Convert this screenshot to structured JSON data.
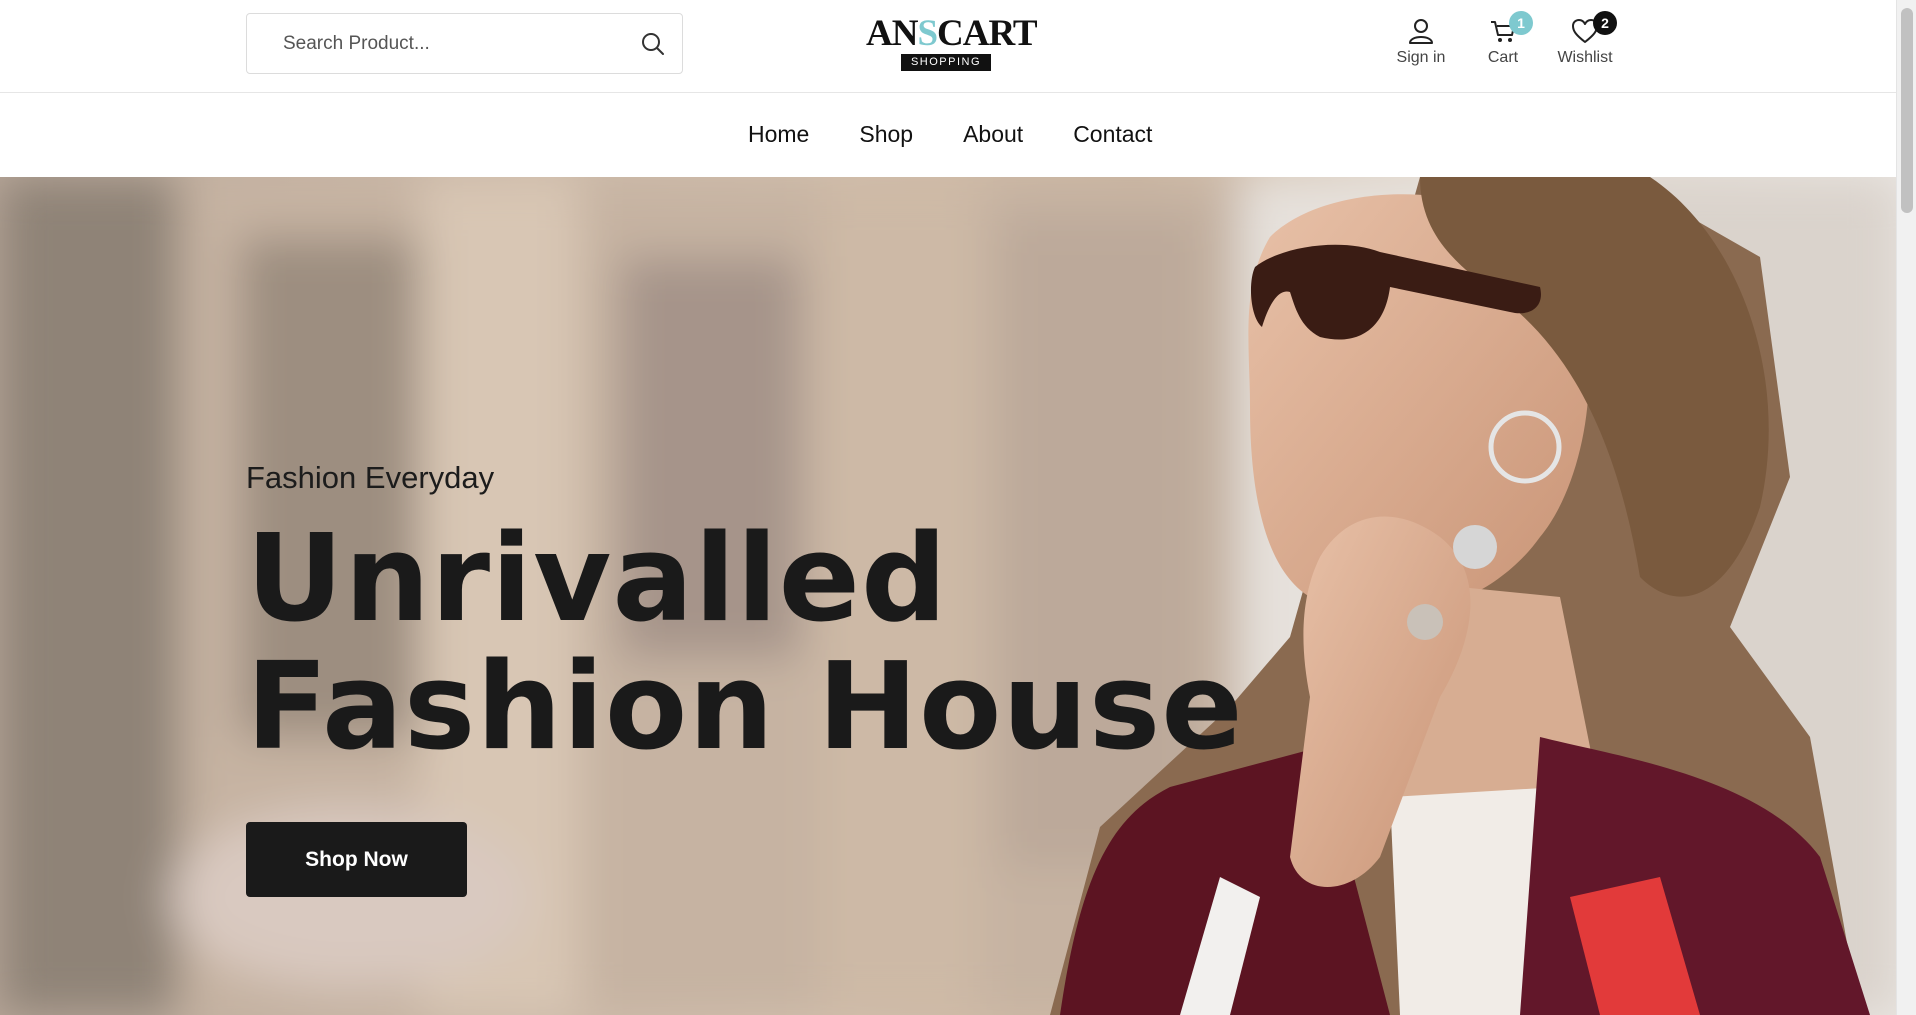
{
  "header": {
    "search": {
      "placeholder": "Search Product...",
      "value": ""
    },
    "logo": {
      "brand_pre": "AN",
      "brand_accent": "S",
      "brand_post": "CART",
      "tagline": "SHOPPING"
    },
    "actions": [
      {
        "label": "Sign in",
        "icon": "user-icon"
      },
      {
        "label": "Cart",
        "icon": "cart-icon",
        "count": "1"
      },
      {
        "label": "Wishlist",
        "icon": "heart-icon",
        "count": "2"
      }
    ]
  },
  "nav": {
    "items": [
      "Home",
      "Shop",
      "About",
      "Contact"
    ]
  },
  "hero": {
    "eyebrow": "Fashion Everyday",
    "headline_line1": "Unrivalled",
    "headline_line2": "Fashion House",
    "cta_label": "Shop Now"
  },
  "colors": {
    "accent": "#7ec9cf",
    "dark": "#1a1a1a"
  }
}
